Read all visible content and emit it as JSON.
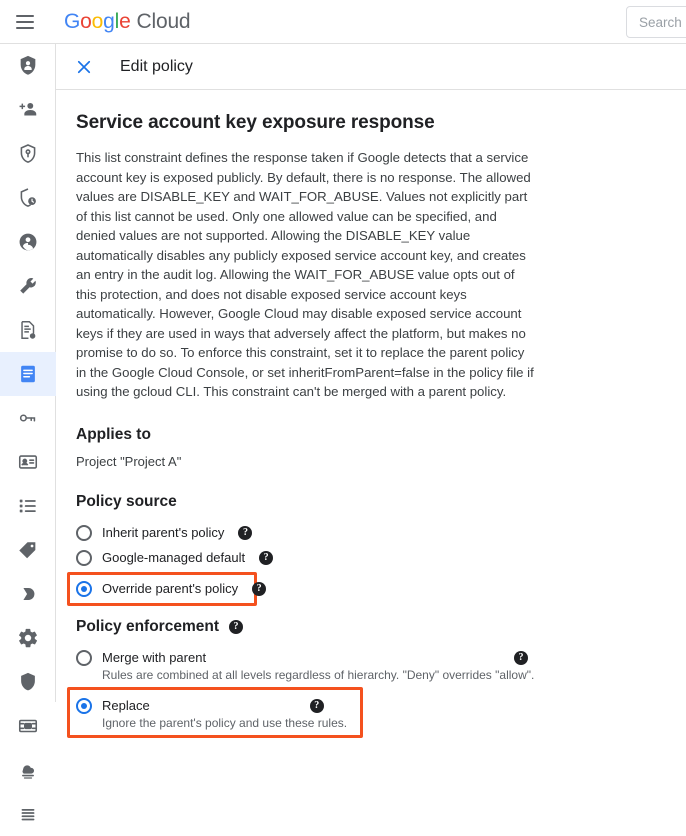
{
  "topbar": {
    "menu_icon": "hamburger-icon",
    "brand": {
      "g1": "G",
      "g2": "o",
      "g3": "o",
      "g4": "g",
      "g5": "l",
      "g6": "e",
      "cloud": "Cloud"
    },
    "search_placeholder": "Search"
  },
  "page": {
    "close_icon": "close-icon",
    "title": "Edit policy"
  },
  "rail": {
    "items": [
      {
        "icon": "shield-person-icon",
        "active": false
      },
      {
        "icon": "add-person-icon",
        "active": false
      },
      {
        "icon": "shield-key-icon",
        "active": false
      },
      {
        "icon": "shield-clock-icon",
        "active": false
      },
      {
        "icon": "account-circle-icon",
        "active": false
      },
      {
        "icon": "wrench-icon",
        "active": false
      },
      {
        "icon": "document-settings-icon",
        "active": false
      },
      {
        "icon": "policy-document-icon",
        "active": true
      },
      {
        "icon": "key-card-icon",
        "active": false
      },
      {
        "icon": "id-card-icon",
        "active": false
      },
      {
        "icon": "list-icon",
        "active": false
      },
      {
        "icon": "tag-icon",
        "active": false
      },
      {
        "icon": "moon-icon",
        "active": false
      },
      {
        "icon": "gear-icon",
        "active": false
      },
      {
        "icon": "shield-icon",
        "active": false
      },
      {
        "icon": "server-icon",
        "active": false
      },
      {
        "icon": "cloud-stack-icon",
        "active": false
      },
      {
        "icon": "menu-lines-icon",
        "active": false
      }
    ]
  },
  "main": {
    "constraint_title": "Service account key exposure response",
    "description": "This list constraint defines the response taken if Google detects that a service account key is exposed publicly. By default, there is no response. The allowed values are DISABLE_KEY and WAIT_FOR_ABUSE. Values not explicitly part of this list cannot be used. Only one allowed value can be specified, and denied values are not supported. Allowing the DISABLE_KEY value automatically disables any publicly exposed service account key, and creates an entry in the audit log. Allowing the WAIT_FOR_ABUSE value opts out of this protection, and does not disable exposed service account keys automatically. However, Google Cloud may disable exposed service account keys if they are used in ways that adversely affect the platform, but makes no promise to do so. To enforce this constraint, set it to replace the parent policy in the Google Cloud Console, or set inheritFromParent=false in the policy file if using the gcloud CLI. This constraint can't be merged with a parent policy.",
    "applies_to": {
      "heading": "Applies to",
      "value": "Project \"Project A\""
    },
    "policy_source": {
      "heading": "Policy source",
      "options": [
        {
          "label": "Inherit parent's policy",
          "selected": false,
          "help": "?"
        },
        {
          "label": "Google-managed default",
          "selected": false,
          "help": "?"
        },
        {
          "label": "Override parent's policy",
          "selected": true,
          "help": "?",
          "highlighted": true
        }
      ]
    },
    "policy_enforcement": {
      "heading": "Policy enforcement",
      "help": "?",
      "options": [
        {
          "label": "Merge with parent",
          "sublabel": "Rules are combined at all levels regardless of hierarchy. \"Deny\" overrides \"allow\".",
          "selected": false,
          "help": "?",
          "highlighted": false
        },
        {
          "label": "Replace",
          "sublabel": "Ignore the parent's policy and use these rules.",
          "selected": true,
          "help": "?",
          "highlighted": true
        }
      ]
    }
  },
  "colors": {
    "accent_blue": "#1a73e8",
    "highlight_orange": "#f4511e",
    "active_rail_bg": "#e8f0fe",
    "text_primary": "#202124",
    "text_secondary": "#5f6368"
  }
}
